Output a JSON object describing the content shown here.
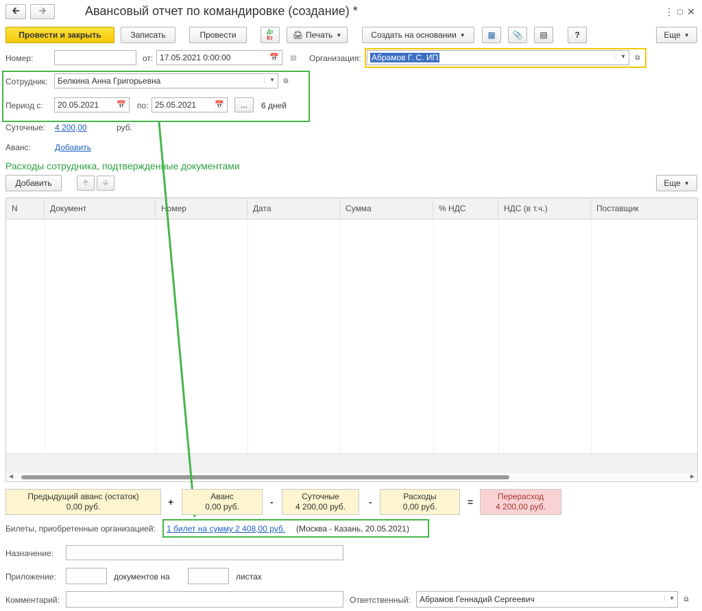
{
  "title_bar": {
    "back_icon": "arrow-left-icon",
    "forward_icon": "arrow-right-icon",
    "title": "Авансовый отчет по командировке (создание) *",
    "menu_icon": "kebab-menu-icon",
    "restore_icon": "maximize-icon",
    "close_icon": "close-icon"
  },
  "toolbar": {
    "post_and_close": "Провести и закрыть",
    "save": "Записать",
    "post": "Провести",
    "dt_kt_top": "Дт",
    "dt_kt_bottom": "Кт",
    "print": "Печать",
    "create_based_on": "Создать на основании",
    "more": "Еще",
    "help": "?"
  },
  "header": {
    "number_label": "Номер:",
    "number_value": "",
    "from_label": "от:",
    "date_value": "17.05.2021  0:00:00",
    "org_label": "Организация:",
    "org_value": "Абрамов Г. С. ИП",
    "employee_label": "Сотрудник:",
    "employee_value": "Белкина Анна Григорьевна",
    "period_label": "Период с:",
    "period_from": "20.05.2021",
    "period_to_label": "по:",
    "period_to": "25.05.2021",
    "period_button": "...",
    "period_days": "6 дней",
    "per_diem_label": "Суточные:",
    "per_diem_value": "4 200,00",
    "per_diem_currency": "руб.",
    "advance_label": "Аванс:",
    "advance_link": "Добавить"
  },
  "expenses": {
    "section_title": "Расходы сотрудника, подтвержденные документами",
    "add_button": "Добавить",
    "more_button": "Еще",
    "columns": [
      "N",
      "Документ",
      "Номер",
      "Дата",
      "Сумма",
      "% НДС",
      "НДС (в т.ч.)",
      "Поставщик"
    ],
    "rows": []
  },
  "totals": {
    "prev_advance_label": "Предыдущий аванс (остаток)",
    "prev_advance_value": "0,00 руб.",
    "plus": "+",
    "advance_label": "Аванс",
    "advance_value": "0,00 руб.",
    "minus1": "-",
    "per_diem_label": "Суточные",
    "per_diem_value": "4 200,00 руб.",
    "minus2": "-",
    "expenses_label": "Расходы",
    "expenses_value": "0,00 руб.",
    "equals": "=",
    "overspend_label": "Перерасход",
    "overspend_value": "4 200,00 руб."
  },
  "tickets": {
    "label": "Билеты, приобретенные организацией:",
    "link": "1 билет на сумму 2 408,00 руб.",
    "detail": "(Москва - Казань, 20.05.2021)"
  },
  "footer": {
    "purpose_label": "Назначение:",
    "purpose_value": "",
    "attachment_label": "Приложение:",
    "attachment_docs": "",
    "docs_on_label": "документов на",
    "attachment_sheets": "",
    "sheets_label": "листах",
    "comment_label": "Комментарий:",
    "comment_value": "",
    "responsible_label": "Ответственный:",
    "responsible_value": "Абрамов Геннадий Сергеевич"
  },
  "colors": {
    "accent_yellow": "#f3c80a",
    "highlight_green": "#45b649",
    "section_title_green": "#2ea043",
    "link_blue": "#1f5fbf",
    "overspend_bg": "#f9d3d3",
    "total_bg": "#fdf5cf"
  }
}
